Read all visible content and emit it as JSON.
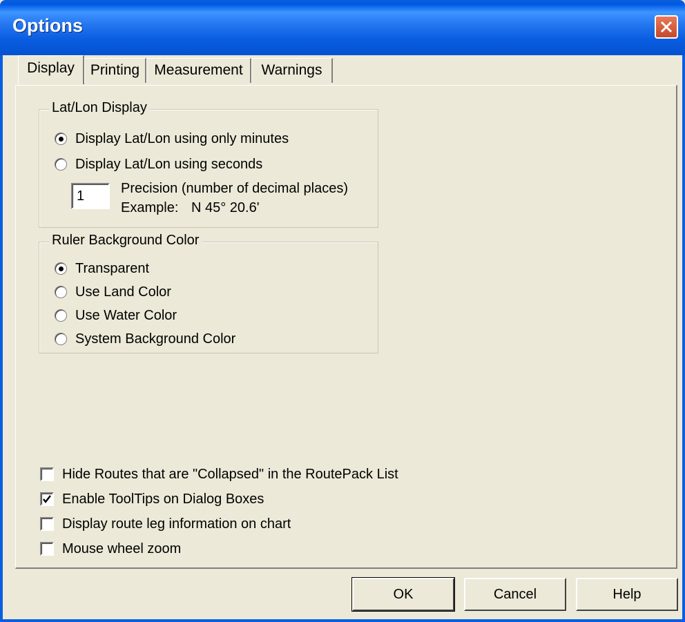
{
  "window": {
    "title": "Options"
  },
  "tabs": [
    {
      "label": "Display",
      "active": true
    },
    {
      "label": "Printing",
      "active": false
    },
    {
      "label": "Measurement",
      "active": false
    },
    {
      "label": "Warnings",
      "active": false
    }
  ],
  "latlon": {
    "title": "Lat/Lon Display",
    "options": [
      {
        "label": "Display Lat/Lon using only minutes",
        "checked": true
      },
      {
        "label": "Display Lat/Lon using seconds",
        "checked": false
      }
    ],
    "precision_value": "1",
    "precision_label": "Precision (number of decimal places)",
    "example_label": "Example:",
    "example_value": "N 45° 20.6'"
  },
  "ruler": {
    "title": "Ruler Background Color",
    "options": [
      {
        "label": "Transparent",
        "checked": true
      },
      {
        "label": "Use Land Color",
        "checked": false
      },
      {
        "label": "Use Water Color",
        "checked": false
      },
      {
        "label": "System Background Color",
        "checked": false
      }
    ]
  },
  "checkboxes": [
    {
      "label": "Hide Routes that are \"Collapsed\" in the RoutePack List",
      "checked": false
    },
    {
      "label": "Enable ToolTips on Dialog Boxes",
      "checked": true
    },
    {
      "label": "Display route leg information on chart",
      "checked": false
    },
    {
      "label": "Mouse wheel zoom",
      "checked": false
    }
  ],
  "buttons": {
    "ok": "OK",
    "cancel": "Cancel",
    "help": "Help"
  },
  "colors": {
    "titlebar": "#0a5ee0",
    "dialog_bg": "#ece9d8",
    "close_button": "#d9623f"
  }
}
